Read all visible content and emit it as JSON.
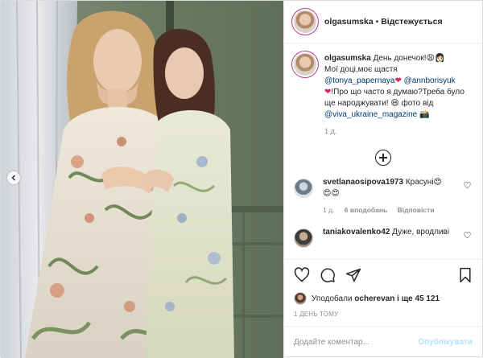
{
  "post": {
    "username": "olgasumska",
    "follow_separator": "•",
    "follow_label": "Відстежується",
    "caption": {
      "username": "olgasumska",
      "line1": "День донечок!",
      "line2": "Мої доці,моє щастя",
      "mention1": "@tonya_papernaya",
      "mention2": "@annborisyuk",
      "line3": "!Про що часто я думаю?Треба було ще народжувати!",
      "line4": "фото від",
      "mention3": "@viva_ukraine_magazine",
      "emoji_faces": "😩👩🏻",
      "emoji_heart": "❤",
      "emoji_smile": "😆",
      "emoji_camera": "📸"
    },
    "caption_time": "1 д.",
    "load_more": "load-more",
    "comments": [
      {
        "username": "svetlanaosipova1973",
        "text": "Красуні",
        "emoji_inline": "😍",
        "emoji_trailing": "😍😍",
        "time": "1 д.",
        "likes": "6 вподобань",
        "reply": "Відповісти"
      },
      {
        "username": "taniakovalenko42",
        "text": "Дуже, вродливі",
        "time": "",
        "likes": "",
        "reply": ""
      }
    ],
    "liked_by_prefix": "Уподобали",
    "liked_by_user": "ocherevan",
    "liked_by_suffix": "і ще 45 121",
    "posted_time": "1 ДЕНЬ ТОМУ",
    "comment_placeholder": "Додайте коментар...",
    "publish_label": "Опублікувати"
  },
  "colors": {
    "wall": "#6e7f66",
    "dress_light": "#e6e4cf",
    "link": "#00376b",
    "publish_disabled": "#b2dffc"
  }
}
